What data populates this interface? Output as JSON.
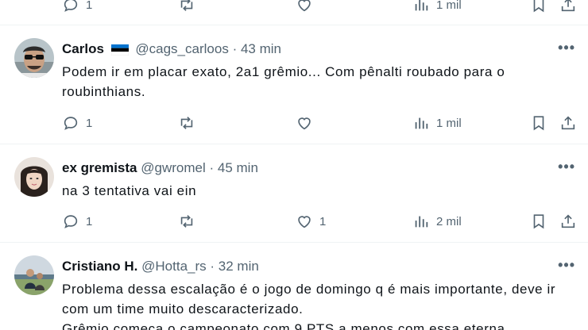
{
  "posts": [
    {
      "actions": {
        "replies": "1",
        "retweets": "",
        "likes": "",
        "views": "1 mil"
      }
    },
    {
      "name": "Carlos",
      "handle": "@cags_carloos",
      "separator": "·",
      "time": "43 min",
      "text": "Podem ir em placar exato, 2a1 grêmio... Com pênalti roubado para o roubinthians.",
      "actions": {
        "replies": "1",
        "retweets": "",
        "likes": "",
        "views": "1 mil"
      }
    },
    {
      "name": "ex gremista",
      "handle": "@gwromel",
      "separator": "·",
      "time": "45 min",
      "text": "na 3 tentativa vai ein",
      "actions": {
        "replies": "1",
        "retweets": "",
        "likes": "1",
        "views": "2 mil"
      }
    },
    {
      "name": "Cristiano H.",
      "handle": "@Hotta_rs",
      "separator": "·",
      "time": "32 min",
      "text": "Problema dessa escalação é o jogo de domingo q é mais importante, deve ir com um time muito descaracterizado.\nGrêmio começa o campeonato com 9 PTS a menos com essa eterna",
      "actions": {}
    }
  ],
  "more_glyph": "•••",
  "colors": {
    "muted": "#536471",
    "text": "#0f1419",
    "divider": "#eff3f4"
  }
}
